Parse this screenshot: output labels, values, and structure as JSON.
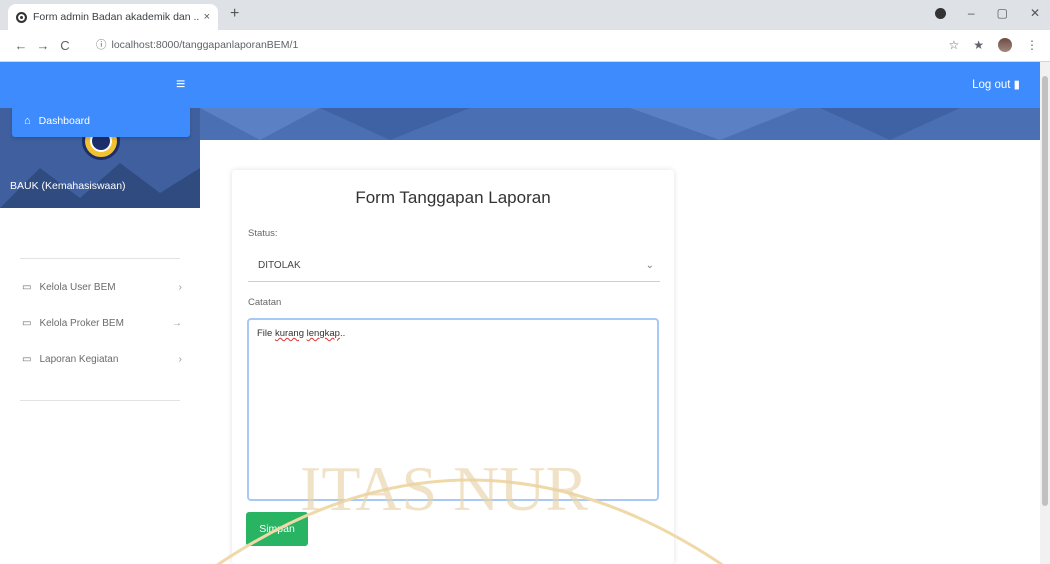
{
  "browser": {
    "tab_title": "Form admin Badan akademik dan ...",
    "tab_close": "×",
    "new_tab": "+",
    "url": "localhost:8000/tanggapanlaporanBEM/1",
    "url_info_icon": "info-icon",
    "nav": {
      "back": "←",
      "forward": "→",
      "reload": "C"
    },
    "right_icons": {
      "star": "☆",
      "extensions": "★",
      "menu": "⋮"
    },
    "window": {
      "minimize": "–",
      "maximize": "▢",
      "close": "✕"
    }
  },
  "header": {
    "menu_icon": "≡",
    "logout_label": "Log out"
  },
  "sidebar": {
    "brand": "BAUK (Kemahasiswaan)",
    "active_item": {
      "label": "Dashboard",
      "icon": "dashboard-icon"
    },
    "items": [
      {
        "label": "Kelola User BEM",
        "arrow": "›"
      },
      {
        "label": "Kelola Proker BEM",
        "arrow": "→"
      },
      {
        "label": "Laporan Kegiatan",
        "arrow": "›"
      }
    ]
  },
  "form": {
    "title": "Form Tanggapan Laporan",
    "status_label": "Status:",
    "status_value": "DITOLAK",
    "notes_label": "Catatan",
    "notes_value": {
      "word1": "File",
      "word2": "kurang",
      "word3": "lengkap",
      "tail": ".."
    },
    "save_label": "Simpan"
  },
  "watermark_text": "ITAS NUR",
  "colors": {
    "primary": "#3d8bfd",
    "banner": "#4a6fb3",
    "success": "#28b463"
  }
}
